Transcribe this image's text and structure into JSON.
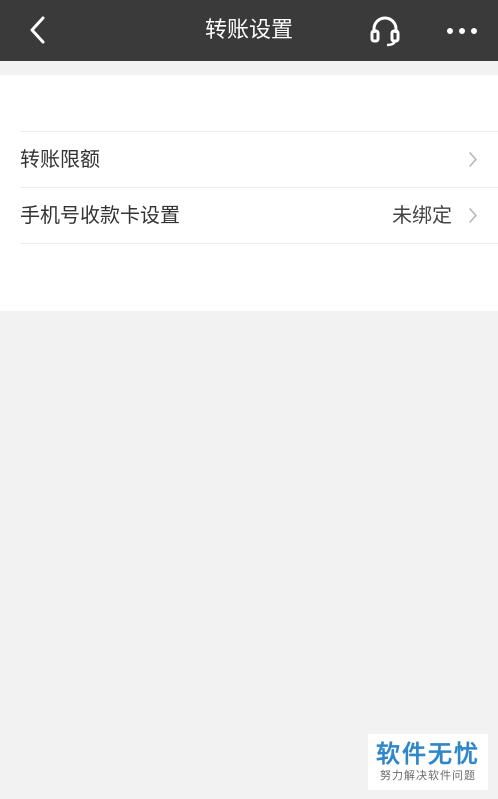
{
  "header": {
    "title": "转账设置",
    "back_icon": "chevron-left-icon",
    "support_icon": "headset-icon",
    "more_icon": "more-horizontal-icon"
  },
  "settings": {
    "items": [
      {
        "label": "转账限额",
        "value": ""
      },
      {
        "label": "手机号收款卡设置",
        "value": "未绑定"
      }
    ]
  },
  "watermark": {
    "title": "软件无忧",
    "subtitle": "努力解决软件问题"
  },
  "colors": {
    "navbar_bg": "#3a3a3a",
    "page_bg": "#f2f2f2",
    "card_bg": "#ffffff",
    "watermark_blue": "#2f86c8"
  }
}
